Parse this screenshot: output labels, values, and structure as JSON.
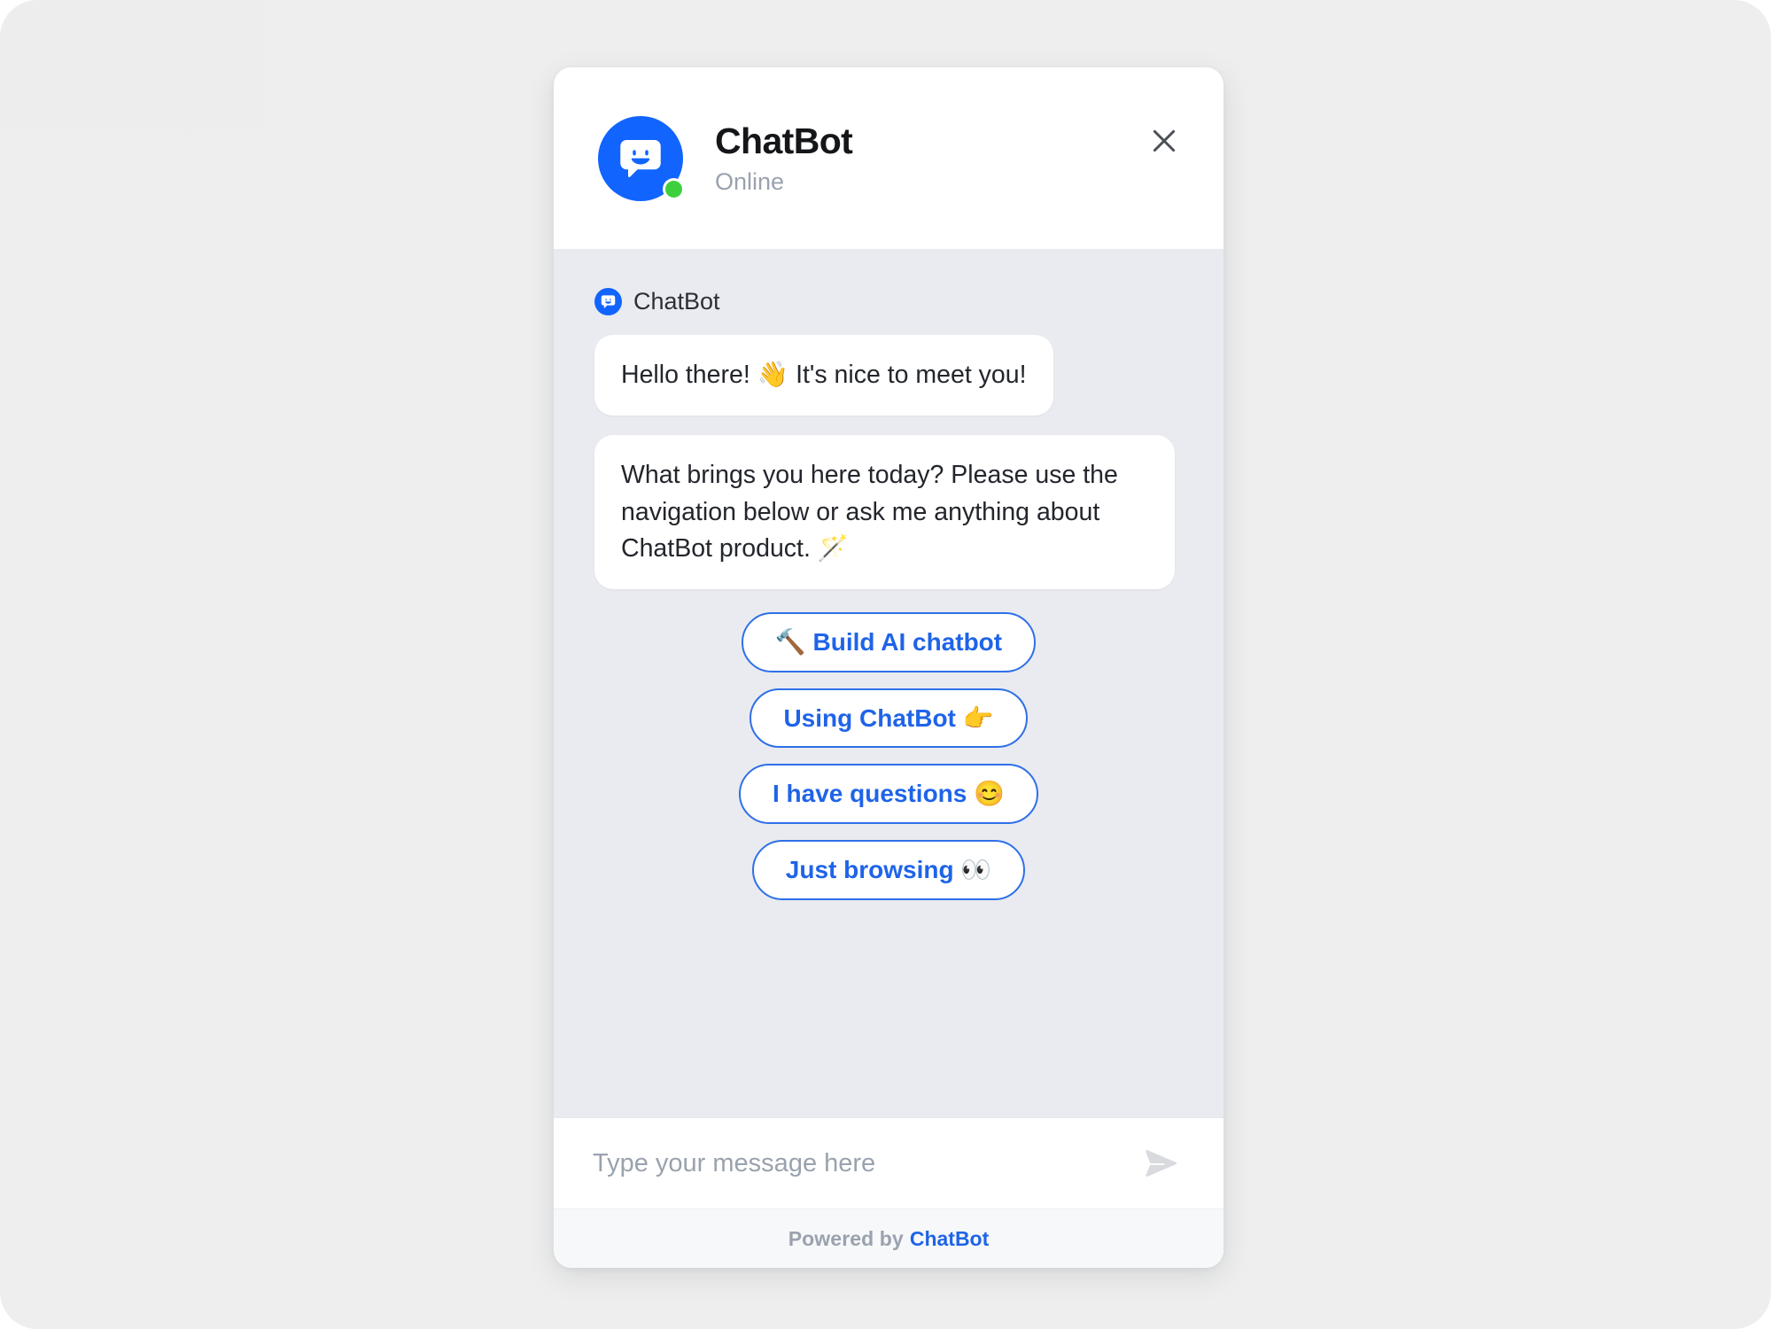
{
  "theme": {
    "accent_blue": "#1f64e8",
    "avatar_blue": "#1264ff",
    "online_green": "#3ecf3e",
    "chat_background": "#e9ebf0",
    "page_background": "#eeeeee",
    "footer_background": "#f7f8f9"
  },
  "header": {
    "avatar_icon": "chatbot-logo-icon",
    "title": "ChatBot",
    "status": "Online",
    "status_indicator": "online-dot",
    "close_icon": "close-icon"
  },
  "conversation": {
    "sender": {
      "avatar_icon": "chatbot-logo-icon",
      "name": "ChatBot"
    },
    "messages": [
      {
        "text": "Hello there! 👋 It's nice to meet you!"
      },
      {
        "text": "What brings you here today? Please use the navigation below or ask me anything about ChatBot product. 🪄"
      }
    ],
    "quick_replies": [
      {
        "label": "🔨 Build AI chatbot"
      },
      {
        "label": "Using ChatBot 👉"
      },
      {
        "label": "I have questions 😊"
      },
      {
        "label": "Just browsing 👀"
      }
    ]
  },
  "composer": {
    "placeholder": "Type your message here",
    "value": "",
    "send_icon": "send-icon"
  },
  "footer": {
    "powered_by": "Powered by",
    "brand": "ChatBot"
  }
}
